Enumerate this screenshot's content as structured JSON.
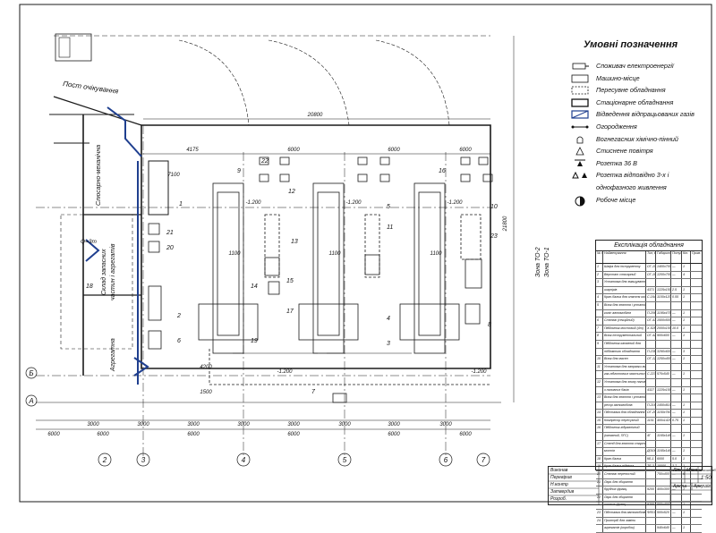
{
  "rooms": {
    "waiting_post": "Пост очікування",
    "locksmith": "Слюсарно-механічна",
    "warehouse_line1": "Склад запасних",
    "warehouse_line2": "частин і агрегатів",
    "aggregate": "Агрегатна",
    "crane_load": "Q=3т"
  },
  "zones": {
    "zone_to2": "Зона ТО-2",
    "zone_to1": "Зона ТО-1"
  },
  "legend": {
    "title": "Умовні позначення",
    "items": [
      {
        "label": "Споживач електроенергії",
        "icon": "electric-consumer-icon"
      },
      {
        "label": "Машино-місце",
        "icon": "vehicle-place-icon"
      },
      {
        "label": "Пересувне обладнання",
        "icon": "mobile-equipment-icon"
      },
      {
        "label": "Стаціонарне обладнання",
        "icon": "stationary-equipment-icon"
      },
      {
        "label": "Відведення відпрацьованих газів",
        "icon": "exhaust-removal-icon"
      },
      {
        "label": "Огородження",
        "icon": "fence-icon"
      },
      {
        "label": "Вогнегасник хімічно-пінний",
        "icon": "extinguisher-icon"
      },
      {
        "label": "Стиснене повітря",
        "icon": "compressed-air-icon"
      },
      {
        "label": "Розетка 36 В",
        "icon": "socket-36v-icon"
      },
      {
        "label": "Розетка відповідно 3-х і",
        "icon": "socket-3phase-icon"
      },
      {
        "label": "однофазного живлення",
        "icon": ""
      },
      {
        "label": "Робоче місце",
        "icon": "workplace-icon"
      }
    ]
  },
  "dimensions": {
    "total_width": "20800",
    "bays": [
      "4175",
      "6000",
      "6000",
      "6000"
    ],
    "left_depth": "7100",
    "right_height": "21800",
    "bottom_top_row": [
      "3000",
      "3000",
      "3000",
      "3000",
      "3000",
      "3000",
      "3000",
      "3000"
    ],
    "bottom_bottom_row": [
      "6000",
      "6000",
      "6000",
      "6000",
      "6000",
      "6000"
    ],
    "pit_marks": [
      "-1.200",
      "-1.200",
      "-1.200"
    ],
    "lower_marks": [
      "-1.200",
      "-1.200"
    ],
    "lift_dims": [
      "1100",
      "1100",
      "1100"
    ],
    "side_dims": [
      "4200",
      "1500"
    ]
  },
  "axes": {
    "columns": [
      "2",
      "3",
      "4",
      "5",
      "6",
      "7"
    ],
    "rows": [
      "Б",
      "А"
    ]
  },
  "equipment_numbers": {
    "list": [
      "1",
      "2",
      "3",
      "4",
      "5",
      "6",
      "7",
      "8",
      "9",
      "10",
      "11",
      "12",
      "13",
      "14",
      "15",
      "16",
      "17",
      "18",
      "19",
      "20",
      "21",
      "22",
      "23"
    ]
  },
  "spec": {
    "title": "Експлікація обладнання",
    "headers": [
      "№ поз.",
      "Найменування",
      "Тип, модель",
      "Габарити, мм",
      "Потуж. кВт",
      "Кіл.",
      "Прим."
    ],
    "rows": [
      [
        "1",
        "Шафа для інструменту",
        "ОГ-1503",
        "1400х700",
        "—",
        "1"
      ],
      [
        "2",
        "Верстат слюсарний",
        "ОГ-103",
        "1200х700",
        "—",
        "4"
      ],
      [
        "3",
        "Установка для змащування",
        "",
        "",
        "",
        ""
      ],
      [
        "",
        "шарнірів",
        "4371",
        "1225х1500",
        "2.5",
        "1"
      ],
      [
        "4",
        "Кран-балка для зняття коліс",
        "С-164",
        "1100х1200",
        "0.55",
        "1"
      ],
      [
        "5",
        "Візок для зняття і установки",
        "",
        "",
        "",
        ""
      ],
      [
        "",
        "коліс автомобілів",
        "П-206",
        "1195х475",
        "—",
        "1"
      ],
      [
        "6",
        "Стелаж (секційний)",
        "ОГ-4166",
        "1500х500",
        "—",
        "1"
      ],
      [
        "7",
        "Підйомник мостовий  (4т)",
        "Х-528",
        "2000х1550",
        "10.0",
        "1"
      ],
      [
        "8",
        "Візок інструментальний",
        "ОГ-4212",
        "900х600",
        "—",
        "1"
      ],
      [
        "9",
        "Підйомник канавний для",
        "",
        "",
        "",
        ""
      ],
      [
        "",
        "підйомного обладнання",
        "П-238",
        "3290х600",
        "—",
        "3"
      ],
      [
        "10",
        "Візок для масел",
        "ОГ-1230",
        "1250х400",
        "—",
        "1"
      ],
      [
        "11",
        "Установка для заправки мастил",
        "",
        "",
        "",
        ""
      ],
      [
        "",
        "газ-підготовчих мастильн.",
        "С-223",
        "570х540",
        "—",
        "1"
      ],
      [
        "12",
        "Установка для зливу палива",
        "",
        "",
        "",
        ""
      ],
      [
        "",
        "з паливних баків",
        "4327",
        "1225х1550",
        "—",
        "1"
      ],
      [
        "13",
        "Візок для зняття і установки",
        "",
        "",
        "",
        ""
      ],
      [
        "",
        "ресор автомобілів",
        "П-216",
        "1450х810",
        "—",
        "1"
      ],
      [
        "14",
        "Підставка для обладнання",
        "ОГ-2011",
        "1150х760",
        "—",
        "1"
      ],
      [
        "15",
        "Компресор пересувний",
        "1101",
        "400х1425",
        "0.75",
        "1"
      ],
      [
        "16",
        "Підйомник гідравлічний",
        "",
        "",
        "",
        ""
      ],
      [
        "",
        "(канавний, ПГС)",
        "4Г",
        "1165х1465",
        "—",
        "1"
      ],
      [
        "17",
        "Стенд для зняття стартерних",
        "",
        "",
        "",
        ""
      ],
      [
        "",
        "мостів",
        "Д0100",
        "1165х1465",
        "—",
        "1"
      ],
      [
        "18",
        "Кран-балка",
        "КБ-1",
        "6000",
        "5.0",
        "1"
      ],
      [
        "19",
        "Кран-балка підвісна",
        "ТЕ-3",
        "10000",
        "3.7",
        "1"
      ],
      [
        "20",
        "Стелаж переносний",
        "",
        "750х400",
        "—",
        "6"
      ],
      [
        "21",
        "Ларь для збирання",
        "",
        "",
        "",
        ""
      ],
      [
        "",
        "брудних фракц.",
        "9200",
        "400х300",
        "—",
        "1"
      ],
      [
        "22",
        "Ларь для збирання",
        "",
        "",
        "",
        ""
      ],
      [
        "",
        "чистих фракц.",
        "9200",
        "500х400",
        "—",
        "1"
      ],
      [
        "23",
        "Підставка для автомобілів",
        "ФЛ0108",
        "500х520",
        "—",
        "1"
      ],
      [
        "24",
        "Пристрій для заміни",
        "",
        "",
        "",
        ""
      ],
      [
        "",
        "агрегатів (коробок)",
        "",
        "940х640",
        "—",
        "1"
      ]
    ]
  },
  "stamp": {
    "rows": [
      "Виконав",
      "Перевірив",
      "Н.контр",
      "Затвердив",
      "Розроб."
    ],
    "lit": "Літ.",
    "mass": "Маса",
    "scale": "Масштаб",
    "scale_value": "1:50",
    "sheet": "Аркуш",
    "sheets": "Аркушів"
  },
  "colors": {
    "line": "#1a1a1a",
    "exhaust": "#1f3f8f",
    "bg": "#ffffff"
  }
}
